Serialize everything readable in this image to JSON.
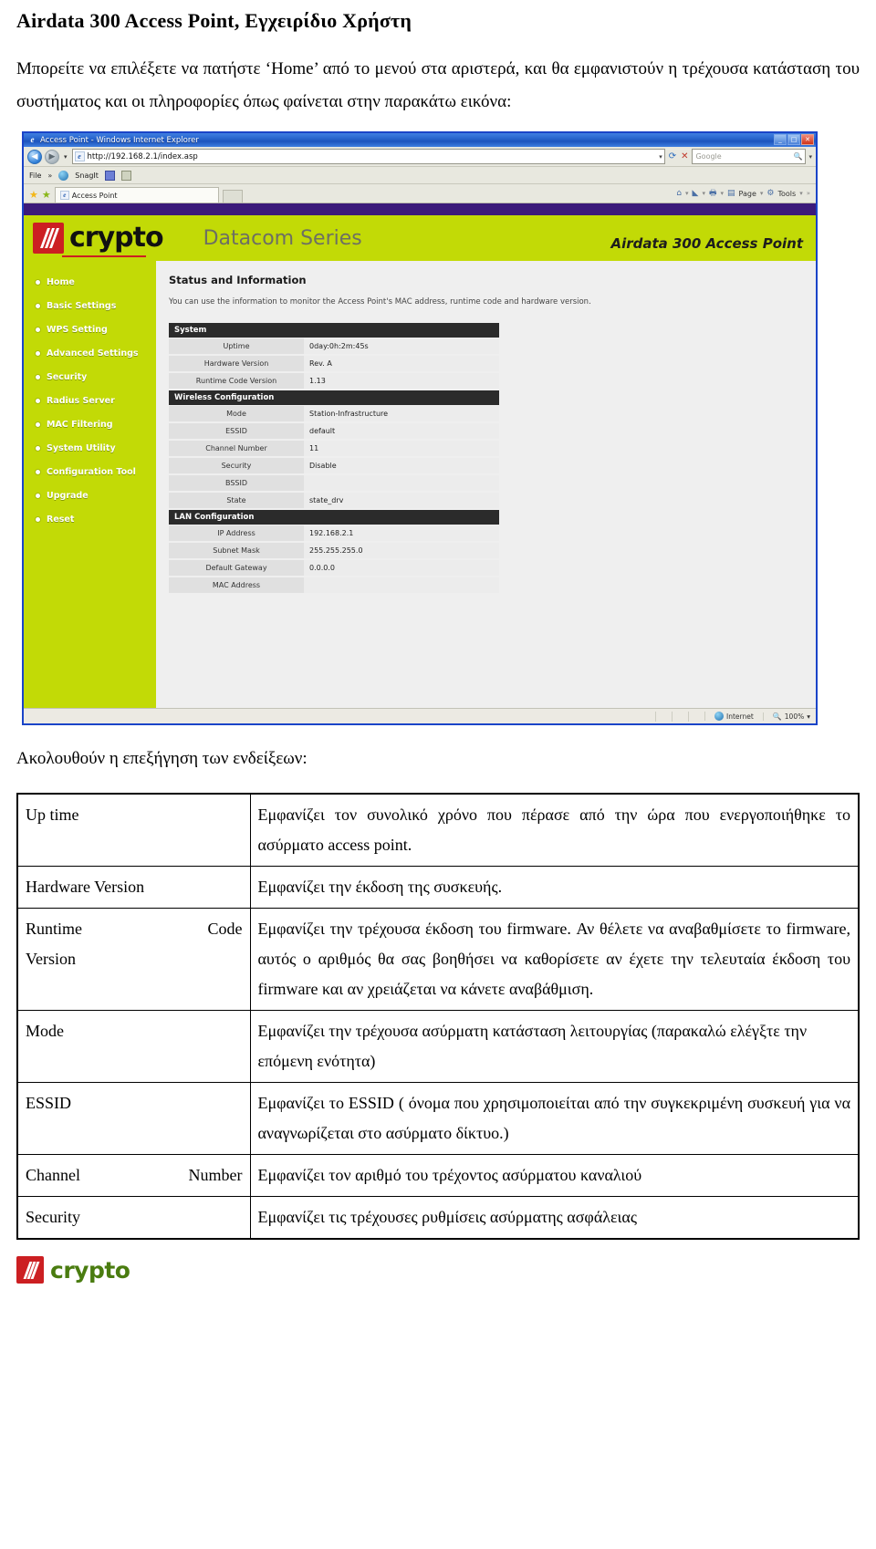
{
  "document": {
    "title": "Airdata 300 Access Point, Εγχειρίδιο Χρήστη",
    "intro_paragraph": "Μπορείτε να επιλέξετε να πατήστε ‘Home’ από το μενού στα αριστερά, και θα εμφανιστούν η τρέχουσα κατάσταση του συστήματος και οι πληροφορίες όπως φαίνεται στην παρακάτω εικόνα:",
    "after_paragraph": "Ακολουθούν η επεξήγηση των ενδείξεων:"
  },
  "browser": {
    "window_title": "Access Point - Windows Internet Explorer",
    "url": "http://192.168.2.1/index.asp",
    "search_placeholder": "Google",
    "menu": {
      "file": "File",
      "overflow": "»",
      "snagit": "SnagIt"
    },
    "tab": {
      "label": "Access Point"
    },
    "toolbar": {
      "page": "Page",
      "tools": "Tools",
      "overflow": "»"
    },
    "window_buttons": {
      "minimize": "_",
      "maximize": "□",
      "close": "✕"
    },
    "statusbar": {
      "zone": "Internet",
      "zoom": "100%"
    }
  },
  "ap": {
    "brand": "crypto",
    "series": "Datacom Series",
    "model": "Airdata 300 Access Point",
    "sidebar": [
      {
        "label": "Home"
      },
      {
        "label": "Basic Settings"
      },
      {
        "label": "WPS Setting"
      },
      {
        "label": "Advanced Settings"
      },
      {
        "label": "Security"
      },
      {
        "label": "Radius Server"
      },
      {
        "label": "MAC Filtering"
      },
      {
        "label": "System Utility"
      },
      {
        "label": "Configuration Tool"
      },
      {
        "label": "Upgrade"
      },
      {
        "label": "Reset"
      }
    ],
    "page_heading": "Status and Information",
    "page_desc": "You can use the information to monitor the Access Point's MAC address, runtime code and hardware version.",
    "sections": [
      {
        "title": "System",
        "rows": [
          {
            "key": "Uptime",
            "value": "0day:0h:2m:45s"
          },
          {
            "key": "Hardware Version",
            "value": "Rev. A"
          },
          {
            "key": "Runtime Code Version",
            "value": "1.13"
          }
        ]
      },
      {
        "title": "Wireless Configuration",
        "rows": [
          {
            "key": "Mode",
            "value": "Station-Infrastructure"
          },
          {
            "key": "ESSID",
            "value": "default"
          },
          {
            "key": "Channel Number",
            "value": "11"
          },
          {
            "key": "Security",
            "value": "Disable"
          },
          {
            "key": "BSSID",
            "value": ""
          },
          {
            "key": "State",
            "value": "state_drv"
          }
        ]
      },
      {
        "title": "LAN Configuration",
        "rows": [
          {
            "key": "IP Address",
            "value": "192.168.2.1"
          },
          {
            "key": "Subnet Mask",
            "value": "255.255.255.0"
          },
          {
            "key": "Default Gateway",
            "value": "0.0.0.0"
          },
          {
            "key": "MAC Address",
            "value": ""
          }
        ]
      }
    ]
  },
  "legend": {
    "rows": [
      {
        "term": "Up time",
        "term_left": "Up time",
        "term_right": "",
        "definition": "Εμφανίζει τον συνολικό χρόνο που πέρασε από την ώρα που ενεργοποιήθηκε το ασύρματο access point."
      },
      {
        "term": "Hardware Version",
        "term_left": "Hardware Version",
        "term_right": "",
        "definition": "Εμφανίζει την έκδοση της συσκευής."
      },
      {
        "term": "Runtime Code Version",
        "term_left": "Runtime",
        "term_right": "Code",
        "term_line2": "Version",
        "definition": "Εμφανίζει την τρέχουσα  έκδοση του firmware. Αν θέλετε να αναβαθμίσετε το firmware, αυτός ο αριθμός θα σας βοηθήσει να καθορίσετε αν έχετε την τελευταία έκδοση του firmware και αν χρειάζεται να κάνετε αναβάθμιση."
      },
      {
        "term": "Mode",
        "term_left": "Mode",
        "term_right": "",
        "definition": "Εμφανίζει την τρέχουσα ασύρματη κατάσταση λειτουργίας (παρακαλώ ελέγξτε την επόμενη ενότητα)"
      },
      {
        "term": "ESSID",
        "term_left": "ESSID",
        "term_right": "",
        "definition": "Εμφανίζει το ESSID ( όνομα που χρησιμοποιείται από την συγκεκριμένη συσκευή για να αναγνωρίζεται στο ασύρματο δίκτυο.)"
      },
      {
        "term": "Channel Number",
        "term_left": "Channel",
        "term_right": "Number",
        "definition": "Εμφανίζει τον αριθμό του τρέχοντος ασύρματου καναλιού"
      },
      {
        "term": "Security",
        "term_left": "Security",
        "term_right": "",
        "definition": "Εμφανίζει τις τρέχουσες ρυθμίσεις ασύρματης ασφάλειας"
      }
    ]
  },
  "footer": {
    "brand": "crypto"
  },
  "colors": {
    "brand_green": "#c2da06",
    "brand_red": "#cc1f22",
    "purple_bar": "#3b1a7a",
    "footer_green": "#4a7c10"
  }
}
